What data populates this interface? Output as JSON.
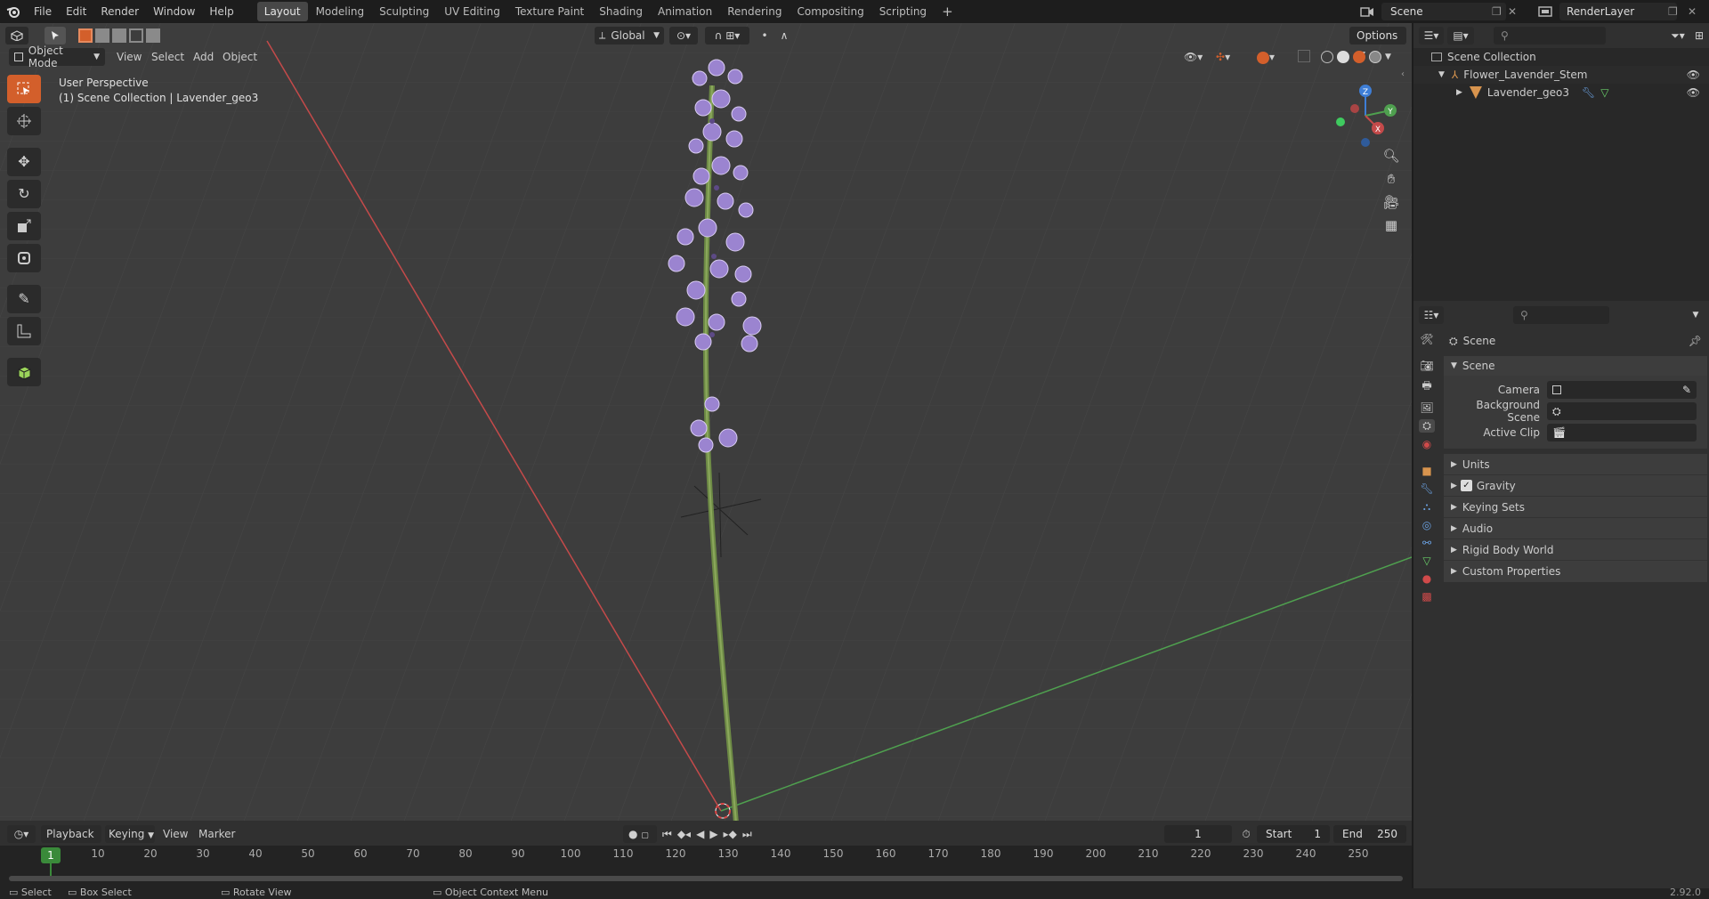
{
  "app": {
    "name": "Blender",
    "version": "2.92.0"
  },
  "topbar": {
    "menus": [
      "File",
      "Edit",
      "Render",
      "Window",
      "Help"
    ],
    "workspaces": [
      "Layout",
      "Modeling",
      "Sculpting",
      "UV Editing",
      "Texture Paint",
      "Shading",
      "Animation",
      "Rendering",
      "Compositing",
      "Scripting"
    ],
    "active_workspace": "Layout",
    "add_workspace": "+",
    "scene": "Scene",
    "view_layer": "RenderLayer"
  },
  "viewport": {
    "mode": "Object Mode",
    "menus": [
      "View",
      "Select",
      "Add",
      "Object"
    ],
    "transform_orientation": "Global",
    "options_label": "Options",
    "overlay_title": "User Perspective",
    "overlay_subtitle": "(1) Scene Collection | Lavender_geo3",
    "gizmo_axes": {
      "z": "Z",
      "y": "Y",
      "x": "X"
    },
    "colors": {
      "x_axis": "#c44a4a",
      "y_axis": "#4fa04f",
      "z_axis": "#3e7ed6",
      "tool_active": "#d35f2b",
      "lavender": "#9b84d0",
      "stem": "#6d8a45"
    }
  },
  "tools": [
    "select-box",
    "cursor",
    "move",
    "rotate",
    "scale",
    "transform",
    "annotate",
    "measure",
    "add-cube"
  ],
  "outliner": {
    "root": "Scene Collection",
    "items": [
      {
        "label": "Flower_Lavender_Stem",
        "level": 1
      },
      {
        "label": "Lavender_geo3",
        "level": 2
      }
    ]
  },
  "properties": {
    "header": "Scene",
    "panel_title": "Scene",
    "fields": [
      {
        "label": "Camera",
        "value": ""
      },
      {
        "label": "Background Scene",
        "value": ""
      },
      {
        "label": "Active Clip",
        "value": ""
      }
    ],
    "subpanels": [
      {
        "label": "Units",
        "checkbox": false
      },
      {
        "label": "Gravity",
        "checkbox": true
      },
      {
        "label": "Keying Sets",
        "checkbox": false
      },
      {
        "label": "Audio",
        "checkbox": false
      },
      {
        "label": "Rigid Body World",
        "checkbox": false
      },
      {
        "label": "Custom Properties",
        "checkbox": false
      }
    ]
  },
  "timeline": {
    "menus": [
      "Playback",
      "Keying",
      "View",
      "Marker"
    ],
    "current_frame": "1",
    "start_label": "Start",
    "start": "1",
    "end_label": "End",
    "end": "250",
    "ruler": [
      "10",
      "20",
      "30",
      "40",
      "50",
      "60",
      "70",
      "80",
      "90",
      "100",
      "110",
      "120",
      "130",
      "140",
      "150",
      "160",
      "170",
      "180",
      "190",
      "200",
      "210",
      "220",
      "230",
      "240",
      "250"
    ],
    "playhead": "1"
  },
  "statusbar": {
    "items": [
      "Select",
      "Box Select",
      "Rotate View",
      "Object Context Menu"
    ],
    "version": "2.92.0"
  }
}
